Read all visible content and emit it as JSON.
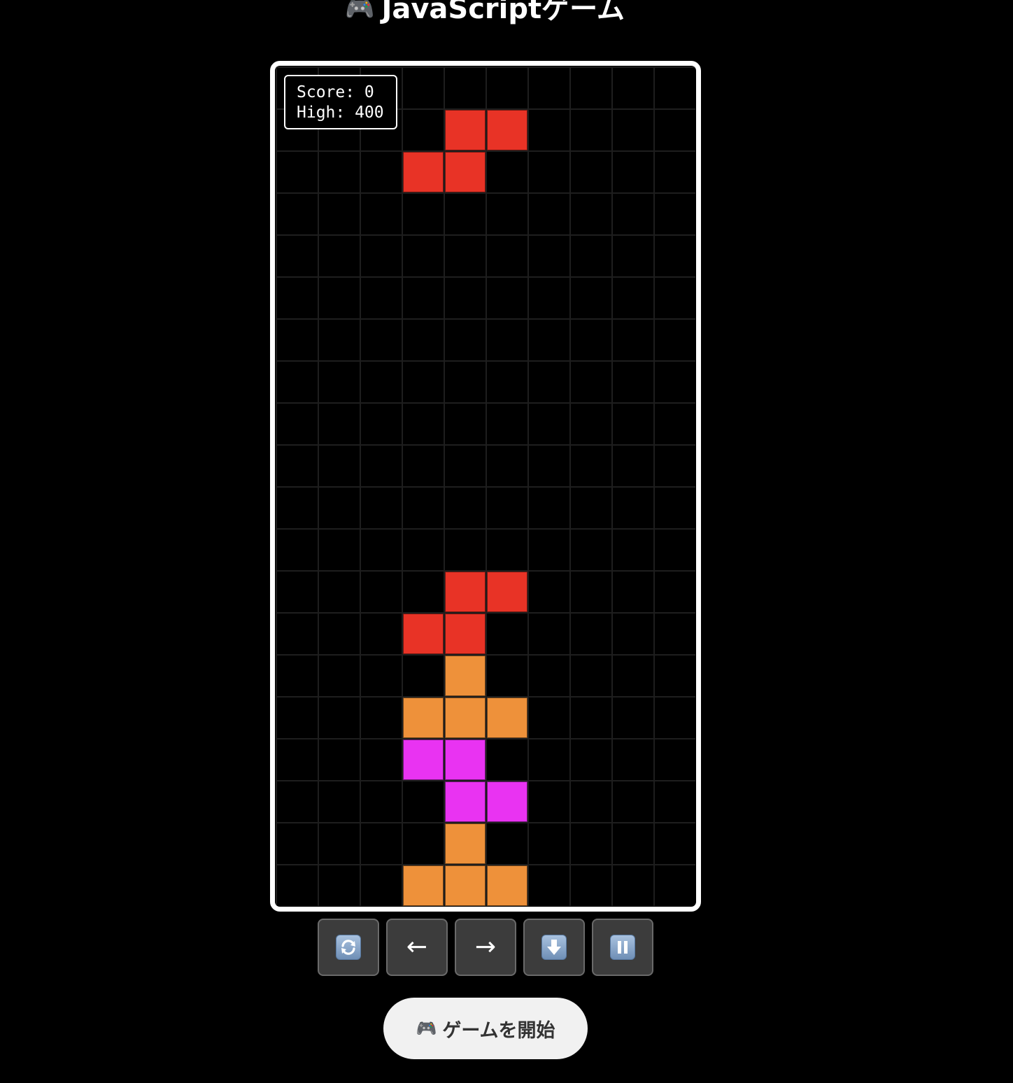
{
  "header": {
    "icon": "gamepad-icon",
    "title": "JavaScriptゲーム"
  },
  "board": {
    "columns": 10,
    "rows": 20,
    "background_color": "#000000",
    "grid_line_color": "#1e1e1e",
    "border_color": "#ffffff",
    "colors": {
      "Z": "#e83326",
      "T": "#ee913a",
      "S": "#e933f2"
    },
    "cells": [
      {
        "col": 4,
        "row": 1,
        "piece": "Z"
      },
      {
        "col": 5,
        "row": 1,
        "piece": "Z"
      },
      {
        "col": 3,
        "row": 2,
        "piece": "Z"
      },
      {
        "col": 4,
        "row": 2,
        "piece": "Z"
      },
      {
        "col": 4,
        "row": 12,
        "piece": "Z"
      },
      {
        "col": 5,
        "row": 12,
        "piece": "Z"
      },
      {
        "col": 3,
        "row": 13,
        "piece": "Z"
      },
      {
        "col": 4,
        "row": 13,
        "piece": "Z"
      },
      {
        "col": 4,
        "row": 14,
        "piece": "T"
      },
      {
        "col": 3,
        "row": 15,
        "piece": "T"
      },
      {
        "col": 4,
        "row": 15,
        "piece": "T"
      },
      {
        "col": 5,
        "row": 15,
        "piece": "T"
      },
      {
        "col": 3,
        "row": 16,
        "piece": "S"
      },
      {
        "col": 4,
        "row": 16,
        "piece": "S"
      },
      {
        "col": 4,
        "row": 17,
        "piece": "S"
      },
      {
        "col": 5,
        "row": 17,
        "piece": "S"
      },
      {
        "col": 4,
        "row": 18,
        "piece": "T"
      },
      {
        "col": 3,
        "row": 19,
        "piece": "T"
      },
      {
        "col": 4,
        "row": 19,
        "piece": "T"
      },
      {
        "col": 5,
        "row": 19,
        "piece": "T"
      }
    ]
  },
  "score": {
    "score_text": "Score: 0",
    "high_text": "High: 400",
    "score": 0,
    "high": 400
  },
  "controls": [
    {
      "name": "rotate-button",
      "icon": "rotate-icon"
    },
    {
      "name": "move-left-button",
      "label": "←",
      "icon": "arrow-left-icon"
    },
    {
      "name": "move-right-button",
      "label": "→",
      "icon": "arrow-right-icon"
    },
    {
      "name": "drop-button",
      "icon": "arrow-down-icon"
    },
    {
      "name": "pause-button",
      "icon": "pause-icon"
    }
  ],
  "start_button": {
    "icon": "gamepad-icon",
    "label": "ゲームを開始"
  }
}
